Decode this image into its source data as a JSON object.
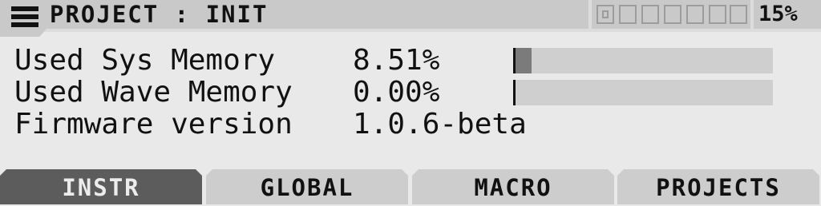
{
  "header": {
    "title": "PROJECT : INIT",
    "instrument_slots": [
      "active",
      "empty",
      "empty",
      "empty",
      "empty",
      "empty",
      "empty",
      "empty"
    ],
    "cpu_load": "15%"
  },
  "info": [
    {
      "label": "Used Sys Memory",
      "value": "8.51%",
      "usage_fraction": 0.0851
    },
    {
      "label": "Used Wave Memory",
      "value": "0.00%",
      "usage_fraction": 0.0
    },
    {
      "label": "Firmware version",
      "value": "1.0.6-beta"
    }
  ],
  "tabs": [
    {
      "label": "INSTR",
      "active": true
    },
    {
      "label": "GLOBAL",
      "active": false
    },
    {
      "label": "MACRO",
      "active": false
    },
    {
      "label": "PROJECTS",
      "active": false
    }
  ],
  "colors": {
    "background": "#e9e9e9",
    "header_bg": "#c9c9c9",
    "bar_track": "#cfcfcf",
    "bar_fill": "#7b7b7b",
    "tab_active_bg": "#5c5c5c",
    "tab_bg": "#cdcdcd"
  }
}
